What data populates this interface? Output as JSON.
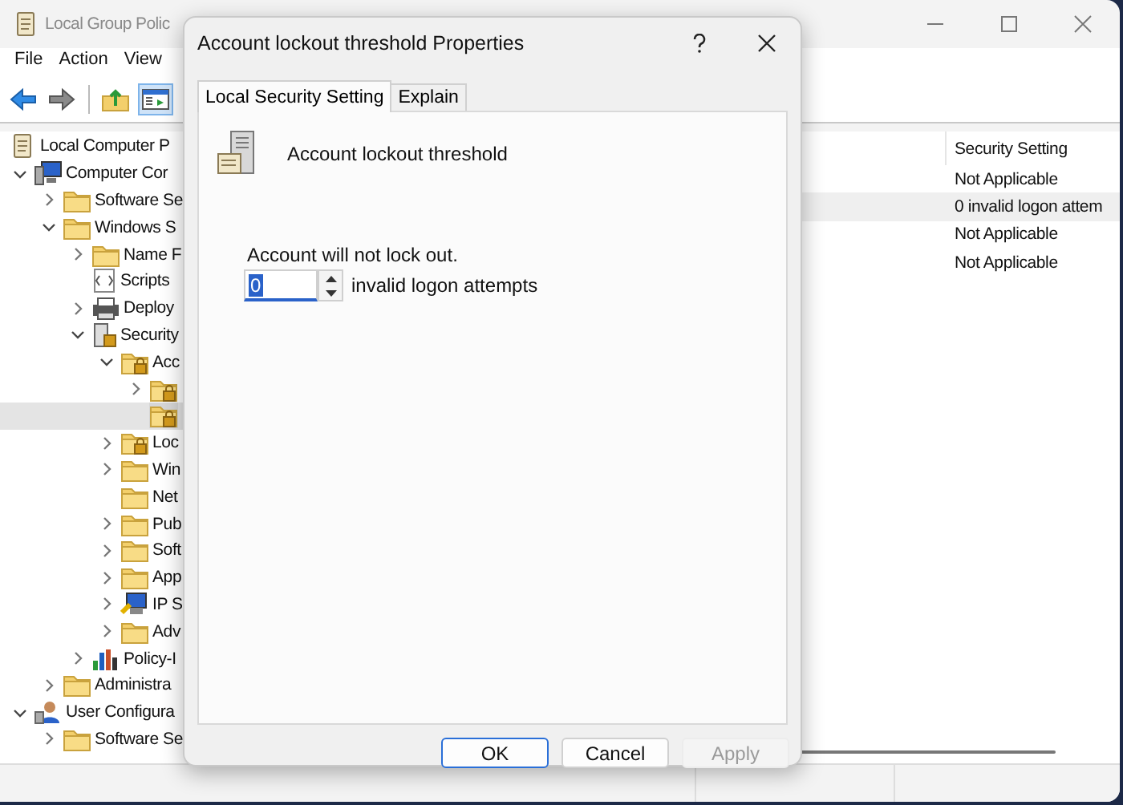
{
  "window": {
    "title": "Local Group Polic"
  },
  "menu": [
    {
      "label": "File"
    },
    {
      "label": "Action"
    },
    {
      "label": "View"
    }
  ],
  "toolbar": [
    {
      "kind": "back",
      "selected": false
    },
    {
      "kind": "forward",
      "selected": false
    },
    {
      "kind": "up-folder",
      "selected": false
    },
    {
      "kind": "tree-toggle",
      "selected": true
    }
  ],
  "tree": {
    "root": {
      "label": "Local Computer P",
      "kind": "policy"
    },
    "items": [
      {
        "label": "Computer Cor",
        "kind": "computer",
        "expanded": true,
        "selected": false,
        "children": [
          {
            "label": "Software Se",
            "kind": "folder",
            "expanded": false,
            "selected": false
          },
          {
            "label": "Windows S",
            "kind": "folder",
            "expanded": true,
            "selected": false,
            "children": [
              {
                "label": "Name F",
                "kind": "folder",
                "expanded": false,
                "selected": false
              },
              {
                "label": "Scripts",
                "kind": "scripts",
                "selected": false
              },
              {
                "label": "Deploy",
                "kind": "printer",
                "expanded": false,
                "selected": false
              },
              {
                "label": "Security",
                "kind": "security",
                "expanded": true,
                "selected": false,
                "children": [
                  {
                    "label": "Acc",
                    "kind": "locked-folder",
                    "expanded": true,
                    "selected": false,
                    "children": [
                      {
                        "kind": "locked-folder",
                        "expanded": false,
                        "selected": false
                      },
                      {
                        "kind": "locked-folder",
                        "selected": true
                      }
                    ]
                  },
                  {
                    "label": "Loc",
                    "kind": "locked-folder",
                    "expanded": false,
                    "selected": false
                  },
                  {
                    "label": "Win",
                    "kind": "folder",
                    "expanded": false,
                    "selected": false
                  },
                  {
                    "label": "Net",
                    "kind": "folder",
                    "selected": false
                  },
                  {
                    "label": "Pub",
                    "kind": "folder",
                    "expanded": false,
                    "selected": false
                  },
                  {
                    "label": "Soft",
                    "kind": "folder",
                    "expanded": false,
                    "selected": false
                  },
                  {
                    "label": "App",
                    "kind": "folder",
                    "expanded": false,
                    "selected": false
                  },
                  {
                    "label": "IP S",
                    "kind": "ip-security",
                    "expanded": false,
                    "selected": false
                  },
                  {
                    "label": "Adv",
                    "kind": "folder",
                    "expanded": false,
                    "selected": false
                  }
                ]
              },
              {
                "label": "Policy-I",
                "kind": "chart",
                "expanded": false,
                "selected": false
              }
            ]
          },
          {
            "label": "Administra",
            "kind": "folder",
            "expanded": false,
            "selected": false
          }
        ]
      },
      {
        "label": "User Configura",
        "kind": "user",
        "expanded": true,
        "selected": false,
        "children": [
          {
            "label": "Software Se",
            "kind": "folder",
            "expanded": false,
            "selected": false
          }
        ]
      }
    ]
  },
  "list": {
    "columns": [
      {
        "label": "Security Setting"
      }
    ],
    "rows": [
      {
        "value": "Not Applicable",
        "selected": false
      },
      {
        "value": "0 invalid logon attem",
        "selected": true
      },
      {
        "value": "Not Applicable",
        "selected": false
      },
      {
        "value": "Not Applicable",
        "selected": false
      }
    ]
  },
  "dialog": {
    "title": "Account lockout threshold Properties",
    "tabs": [
      {
        "label": "Local Security Setting",
        "selected": true
      },
      {
        "label": "Explain",
        "selected": false
      }
    ],
    "heading": "Account lockout threshold",
    "status": "Account will not lock out.",
    "spin": {
      "value": "0",
      "unit": "invalid logon attempts"
    },
    "buttons": [
      {
        "label": "OK",
        "kind": "default",
        "disabled": false
      },
      {
        "label": "Cancel",
        "kind": "normal",
        "disabled": false
      },
      {
        "label": "Apply",
        "kind": "normal",
        "disabled": true
      }
    ]
  }
}
